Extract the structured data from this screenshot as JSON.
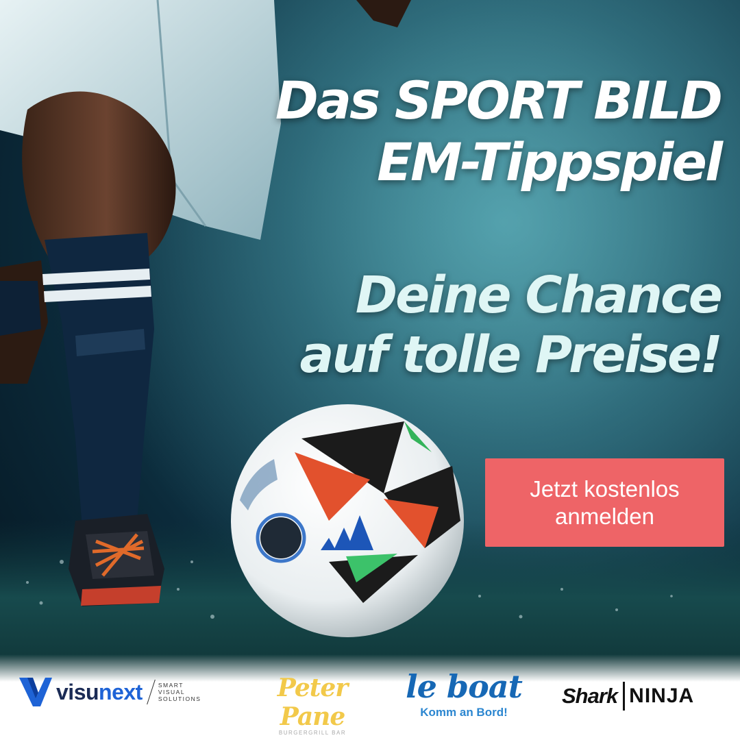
{
  "headline": {
    "line1": "Das SPORT BILD",
    "line2": "EM-Tippspiel"
  },
  "subline": {
    "line1": "Deine Chance",
    "line2": "auf tolle Preise!"
  },
  "cta": {
    "line1": "Jetzt kostenlos",
    "line2": "anmelden"
  },
  "sponsors": {
    "visunext": {
      "name_part1": "visu",
      "name_part2": "next",
      "tagline": [
        "SMART",
        "VISUAL",
        "SOLUTIONS"
      ]
    },
    "peter_pane": {
      "name": "Peter Pane",
      "tagline": "BURGERGRILL BAR"
    },
    "le_boat": {
      "name": "le boat",
      "tagline": "Komm an Bord!"
    },
    "sharkninja": {
      "part1": "Shark",
      "part2": "NINJA"
    }
  },
  "colors": {
    "cta": "#ee6467",
    "headline": "#ffffff",
    "subline": "#dff6f5",
    "background": "#0b2a3a"
  }
}
